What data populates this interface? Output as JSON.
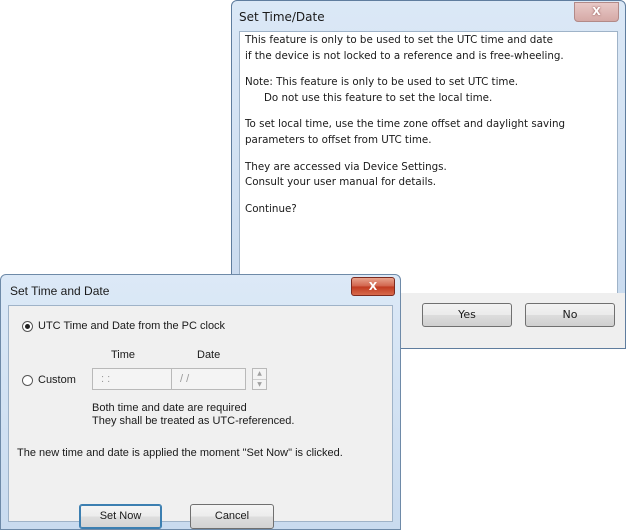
{
  "confirm_dialog": {
    "title": "Set Time/Date",
    "close_label": "X",
    "lines": {
      "l1": "This feature is only to be used to set the UTC time and date",
      "l2": "if the device is not locked to a reference and is free-wheeling.",
      "l3": "Note: This feature is only to be used to set UTC time.",
      "l4": "Do not use this feature to set the local time.",
      "l5": "To set local time, use the time zone offset and daylight saving",
      "l6": "parameters to offset from UTC time.",
      "l7": "They are accessed via Device Settings.",
      "l8": "Consult your user manual for details.",
      "l9": "Continue?"
    },
    "yes_label": "Yes",
    "no_label": "No"
  },
  "set_dialog": {
    "title": "Set Time and Date",
    "close_label": "X",
    "option_pc_label": "UTC Time and Date from the PC clock",
    "option_pc_selected": true,
    "option_custom_label": "Custom",
    "time_header": "Time",
    "date_header": "Date",
    "time_value": " :  : ",
    "date_value": " /  / ",
    "note_line1": "Both time and date are required",
    "note_line2": "They shall be treated as UTC-referenced.",
    "apply_note": "The new time and date is applied the moment  \"Set Now\" is clicked.",
    "set_now_label": "Set Now",
    "cancel_label": "Cancel"
  }
}
